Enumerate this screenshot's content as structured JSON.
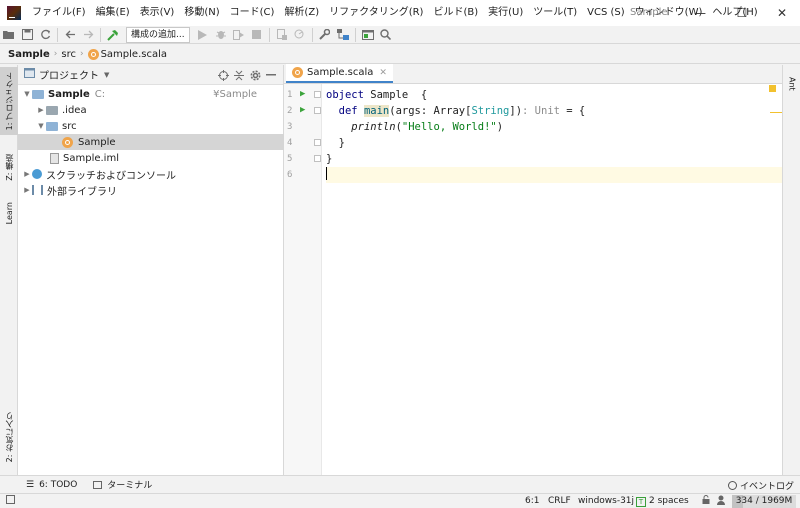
{
  "titlebar": {
    "menu": [
      "ファイル(F)",
      "編集(E)",
      "表示(V)",
      "移動(N)",
      "コード(C)",
      "解析(Z)",
      "リファクタリング(R)",
      "ビルド(B)",
      "実行(U)",
      "ツール(T)",
      "VCS (S)",
      "ウィンドウ(W)",
      "ヘルプ(H)"
    ],
    "window_title": "Sample",
    "minimize_glyph": "—",
    "maximize_glyph": "☐",
    "close_glyph": "✕"
  },
  "toolbar": {
    "config_label": "構成の追加..."
  },
  "breadcrumbs": [
    "Sample",
    "src",
    "Sample.scala"
  ],
  "left_stripe": {
    "project_tab": "1: プロジェクト",
    "structure_tab": "Z: 構造",
    "learn_tab": "Learn",
    "favorites_tab": "2: お気に入り"
  },
  "project_panel": {
    "title": "プロジェクト",
    "tree": [
      {
        "label": "Sample",
        "extra": "C:",
        "path": "¥Sample"
      },
      {
        "label": ".idea"
      },
      {
        "label": "src"
      },
      {
        "label": "Sample"
      },
      {
        "label": "Sample.iml"
      },
      {
        "label": "スクラッチおよびコンソール"
      },
      {
        "label": "外部ライブラリ"
      }
    ]
  },
  "editor": {
    "tab_label": "Sample.scala",
    "line_numbers": [
      "1",
      "2",
      "3",
      "4",
      "5",
      "6"
    ],
    "code": {
      "l1_kw": "object",
      "l1_rest": " Sample  {",
      "l2_indent": "  ",
      "l2_kw": "def",
      "l2_fn": "main",
      "l2_mid": "(args: Array[",
      "l2_type": "String",
      "l2_close": "])",
      "l2_hint": ": Unit",
      "l2_tail": " = {",
      "l3_indent": "    ",
      "l3_fn": "println",
      "l3_open": "(",
      "l3_str": "\"Hello, World!\"",
      "l3_close": ")",
      "l4": "  }",
      "l5": "}"
    }
  },
  "right_stripe": {
    "ant_tab": "Ant"
  },
  "bottom_bar": {
    "todo": "6: TODO",
    "terminal": "ターミナル",
    "event_log": "イベントログ"
  },
  "status_bar": {
    "position": "6:1",
    "line_sep": "CRLF",
    "encoding": "windows-31j",
    "indent": "2 spaces",
    "memory": "334 / 1969M",
    "memory_used_fraction": 0.17
  },
  "colors": {
    "accent": "#4083c9",
    "run_green": "#3ba33b",
    "keyword": "#000080",
    "string": "#067d17"
  }
}
